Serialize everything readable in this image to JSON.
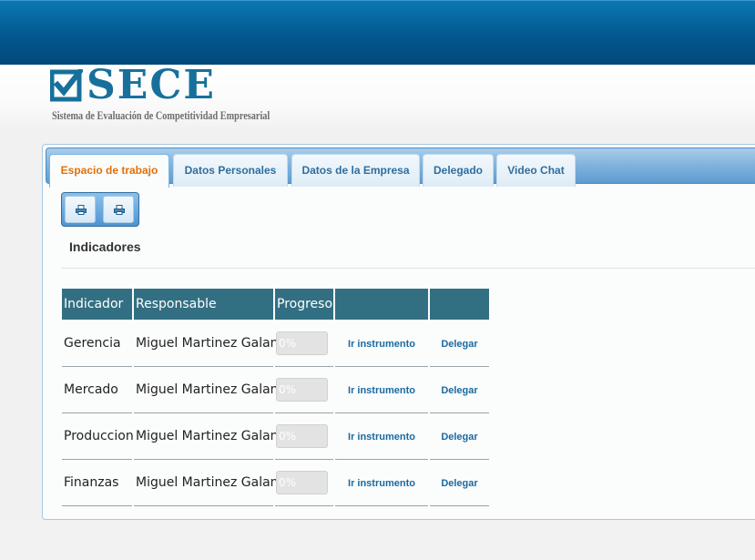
{
  "header": {
    "logo_text": "SECE",
    "logo_subtitle": "Sistema de Evaluación de Competitividad Empresarial"
  },
  "tabs": [
    {
      "label": "Espacio de trabajo",
      "active": true
    },
    {
      "label": "Datos Personales",
      "active": false
    },
    {
      "label": "Datos de la Empresa",
      "active": false
    },
    {
      "label": "Delegado",
      "active": false
    },
    {
      "label": "Video Chat",
      "active": false
    }
  ],
  "toolbar": {
    "buttons": [
      {
        "icon": "printer-icon"
      },
      {
        "icon": "printer-icon"
      }
    ]
  },
  "section": {
    "title": "Indicadores"
  },
  "table": {
    "columns": [
      "Indicador",
      "Responsable",
      "Progreso",
      "",
      ""
    ],
    "rows": [
      {
        "indicador": "Gerencia",
        "responsable": "Miguel Martinez Galan",
        "progreso": "0%",
        "progress_value": 0,
        "action1": "Ir instrumento",
        "action2": "Delegar"
      },
      {
        "indicador": "Mercado",
        "responsable": "Miguel Martinez Galan",
        "progreso": "0%",
        "progress_value": 0,
        "action1": "Ir instrumento",
        "action2": "Delegar"
      },
      {
        "indicador": "Produccion",
        "responsable": "Miguel Martinez Galan",
        "progreso": "0%",
        "progress_value": 0,
        "action1": "Ir instrumento",
        "action2": "Delegar"
      },
      {
        "indicador": "Finanzas",
        "responsable": "Miguel Martinez Galan",
        "progreso": "0%",
        "progress_value": 0,
        "action1": "Ir instrumento",
        "action2": "Delegar"
      }
    ]
  },
  "colors": {
    "brand_blue": "#17709b",
    "header_bar": "#02588f",
    "table_header": "#336f82",
    "active_tab_text": "#e17009",
    "link": "#1b6a9f"
  }
}
